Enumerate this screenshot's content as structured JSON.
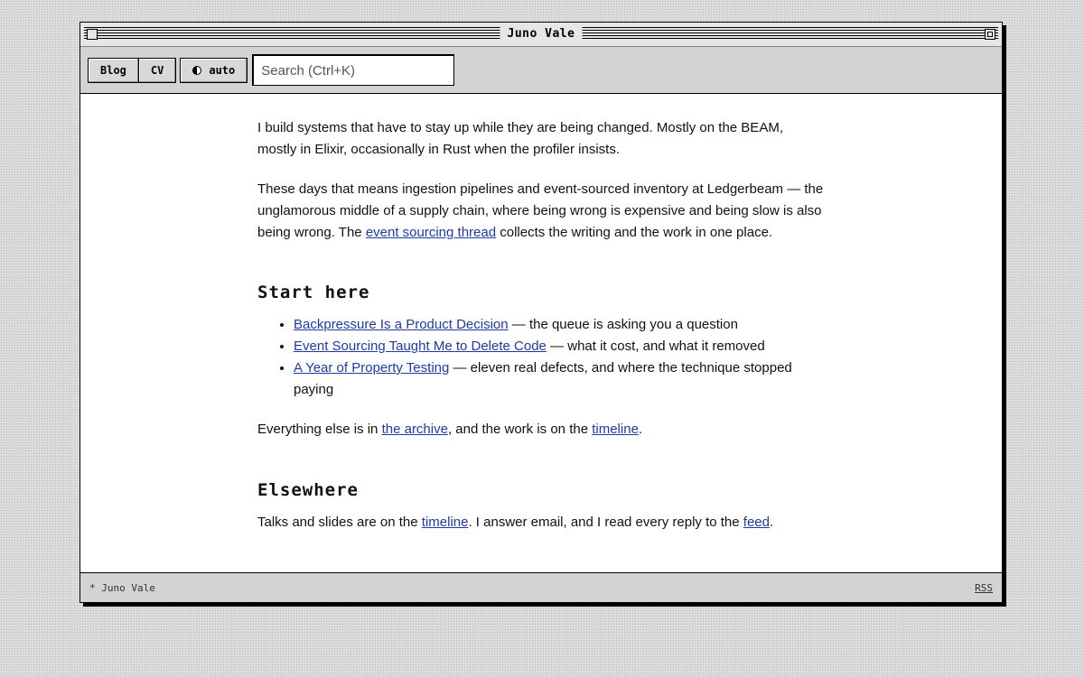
{
  "window": {
    "title": "Juno Vale"
  },
  "toolbar": {
    "blog_label": "Blog",
    "cv_label": "CV",
    "theme_label": "auto",
    "search_placeholder": "Search (Ctrl+K)"
  },
  "intro": {
    "p1": "I build systems that have to stay up while they are being changed. Mostly on the BEAM, mostly in Elixir, occasionally in Rust when the profiler insists.",
    "p2_before": "These days that means ingestion pipelines and event-sourced inventory at Ledgerbeam — the unglamorous middle of a supply chain, where being wrong is expensive and being slow is also being wrong. The ",
    "p2_link": "event sourcing thread",
    "p2_after": " collects the writing and the work in one place."
  },
  "start_here": {
    "heading": "Start here",
    "items": [
      {
        "link": "Backpressure Is a Product Decision",
        "desc": " — the queue is asking you a question"
      },
      {
        "link": "Event Sourcing Taught Me to Delete Code",
        "desc": " — what it cost, and what it removed"
      },
      {
        "link": "A Year of Property Testing",
        "desc": " — eleven real defects, and where the technique stopped paying"
      }
    ],
    "footer_before": "Everything else is in ",
    "footer_link1": "the archive",
    "footer_mid": ", and the work is on the ",
    "footer_link2": "timeline",
    "footer_after": "."
  },
  "elsewhere": {
    "heading": "Elsewhere",
    "text_before": "Talks and slides are on the ",
    "link1": "timeline",
    "text_mid": ". I answer email, and I read every reply to the ",
    "link2": "feed",
    "text_after": "."
  },
  "statusbar": {
    "left": "* Juno Vale",
    "right": "RSS"
  }
}
